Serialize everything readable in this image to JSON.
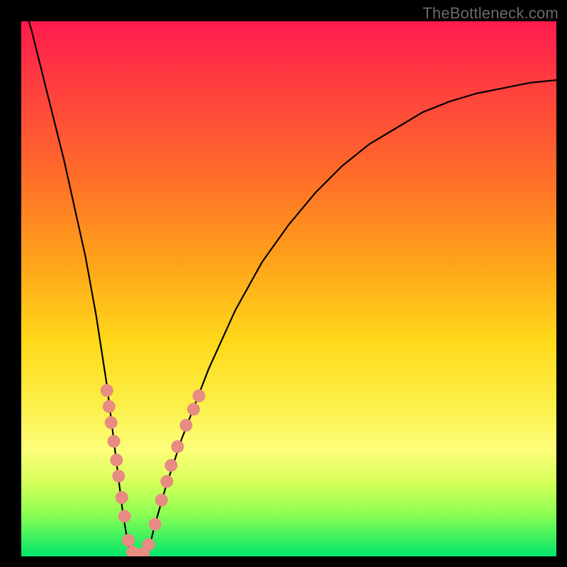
{
  "watermark": "TheBottleneck.com",
  "chart_data": {
    "type": "line",
    "title": "",
    "xlabel": "",
    "ylabel": "",
    "xlim": [
      0,
      100
    ],
    "ylim": [
      0,
      100
    ],
    "series": [
      {
        "name": "bottleneck-curve",
        "x": [
          0,
          2,
          4,
          6,
          8,
          10,
          12,
          14,
          16,
          17,
          18,
          19,
          20,
          21,
          22,
          23,
          24,
          25,
          27,
          30,
          35,
          40,
          45,
          50,
          55,
          60,
          65,
          70,
          75,
          80,
          85,
          90,
          95,
          100
        ],
        "y": [
          105,
          98,
          90,
          82,
          74,
          65,
          56,
          45,
          32,
          24,
          16,
          8,
          2,
          0,
          0,
          0,
          2,
          6,
          13,
          22,
          35,
          46,
          55,
          62,
          68,
          73,
          77,
          80,
          83,
          85,
          86.5,
          87.5,
          88.5,
          89
        ]
      }
    ],
    "markers": {
      "name": "highlighted-points",
      "color": "#e78b83",
      "points": [
        {
          "x": 16.0,
          "y": 31.0
        },
        {
          "x": 16.4,
          "y": 28.0
        },
        {
          "x": 16.8,
          "y": 25.0
        },
        {
          "x": 17.3,
          "y": 21.5
        },
        {
          "x": 17.8,
          "y": 18.0
        },
        {
          "x": 18.2,
          "y": 15.0
        },
        {
          "x": 18.8,
          "y": 11.0
        },
        {
          "x": 19.3,
          "y": 7.5
        },
        {
          "x": 20.0,
          "y": 3.0
        },
        {
          "x": 20.8,
          "y": 0.8
        },
        {
          "x": 21.8,
          "y": 0.3
        },
        {
          "x": 22.8,
          "y": 0.5
        },
        {
          "x": 23.8,
          "y": 2.2
        },
        {
          "x": 25.0,
          "y": 6.0
        },
        {
          "x": 26.2,
          "y": 10.5
        },
        {
          "x": 27.2,
          "y": 14.0
        },
        {
          "x": 28.0,
          "y": 17.0
        },
        {
          "x": 29.2,
          "y": 20.5
        },
        {
          "x": 30.8,
          "y": 24.5
        },
        {
          "x": 32.2,
          "y": 27.5
        },
        {
          "x": 33.2,
          "y": 30.0
        }
      ]
    },
    "gradient_stops": [
      {
        "pos": 0.0,
        "color": "#ff1a4d"
      },
      {
        "pos": 0.12,
        "color": "#ff3f3f"
      },
      {
        "pos": 0.28,
        "color": "#ff6a2a"
      },
      {
        "pos": 0.45,
        "color": "#ffa319"
      },
      {
        "pos": 0.6,
        "color": "#ffd91a"
      },
      {
        "pos": 0.72,
        "color": "#fbf04a"
      },
      {
        "pos": 0.8,
        "color": "#fdff7a"
      },
      {
        "pos": 0.86,
        "color": "#d8ff5a"
      },
      {
        "pos": 0.92,
        "color": "#8eff52"
      },
      {
        "pos": 1.0,
        "color": "#00e56b"
      }
    ]
  }
}
